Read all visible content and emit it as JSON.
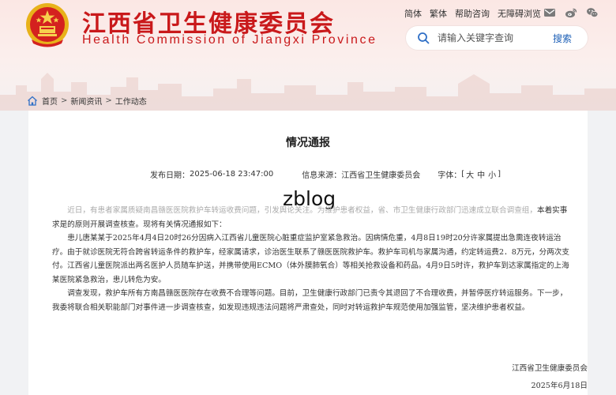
{
  "site": {
    "title": "江西省卫生健康委员会",
    "subtitle": "Health Commission of Jiangxi Province"
  },
  "top_links": [
    "简体",
    "繁体",
    "帮助咨询",
    "无障碍浏览"
  ],
  "top_icons": [
    "mail-icon",
    "weibo-icon",
    "wechat-icon"
  ],
  "search": {
    "placeholder": "请输入关键字查询",
    "button_label": "搜索"
  },
  "breadcrumb": {
    "items": [
      "首页",
      "新闻资讯",
      "工作动态"
    ],
    "separator": ">"
  },
  "article": {
    "title": "情况通报",
    "meta": {
      "date_label": "发布日期：",
      "date_value": "2025-06-18 23:47:00",
      "source_label": "信息来源：",
      "source_value": "江西省卫生健康委员会",
      "font_label": "字体：",
      "font_open": "[",
      "font_sizes": [
        "大",
        "中",
        "小"
      ],
      "font_close": "]"
    },
    "watermark": "zblog",
    "paragraphs": {
      "p1_faded": "近日，有患者家属质疑南昌赣医医院救护车转运收费问题，引发舆论关注。为维护患者权益，省、市卫生健康行政部门迅速成立联合调查组，",
      "p1_strong": "本着实事求是的原则开展调查核查。现将有关情况通报如下：",
      "p2": "患儿唐某某于2025年4月4日20时26分因病入江西省儿童医院心脏重症监护室紧急救治。因病情危重，4月8日19时20分许家属提出急需连夜转运治疗。由于就诊医院无符合跨省转运条件的救护车，经家属请求，诊治医生联系了赣医医院救护车。救护车司机与家属沟通，约定转运费2．8万元，分两次支付。江西省儿童医院派出两名医护人员随车护送，并携带使用ECMO（体外膜肺氧合）等相关抢救设备和药品。4月9日5时许，救护车到达家属指定的上海某医院紧急救治，患儿转危为安。",
      "p3": "调查发现，救护车所有方南昌赣医医院存在收费不合理等问题。目前，卫生健康行政部门已责令其退回了不合理收费，并暂停医疗转运服务。下一步，我委将联合相关职能部门对事件进一步调查核查，如发现违规违法问题将严肃查处，同时对转运救护车规范使用加强监管，坚决维护患者权益。"
    },
    "signature": "江西省卫生健康委员会",
    "sign_date": "2025年6月18日"
  },
  "colors": {
    "brand_red": "#c9191b",
    "search_blue": "#1c5fb6",
    "emblem_gold": "#f0c419"
  }
}
